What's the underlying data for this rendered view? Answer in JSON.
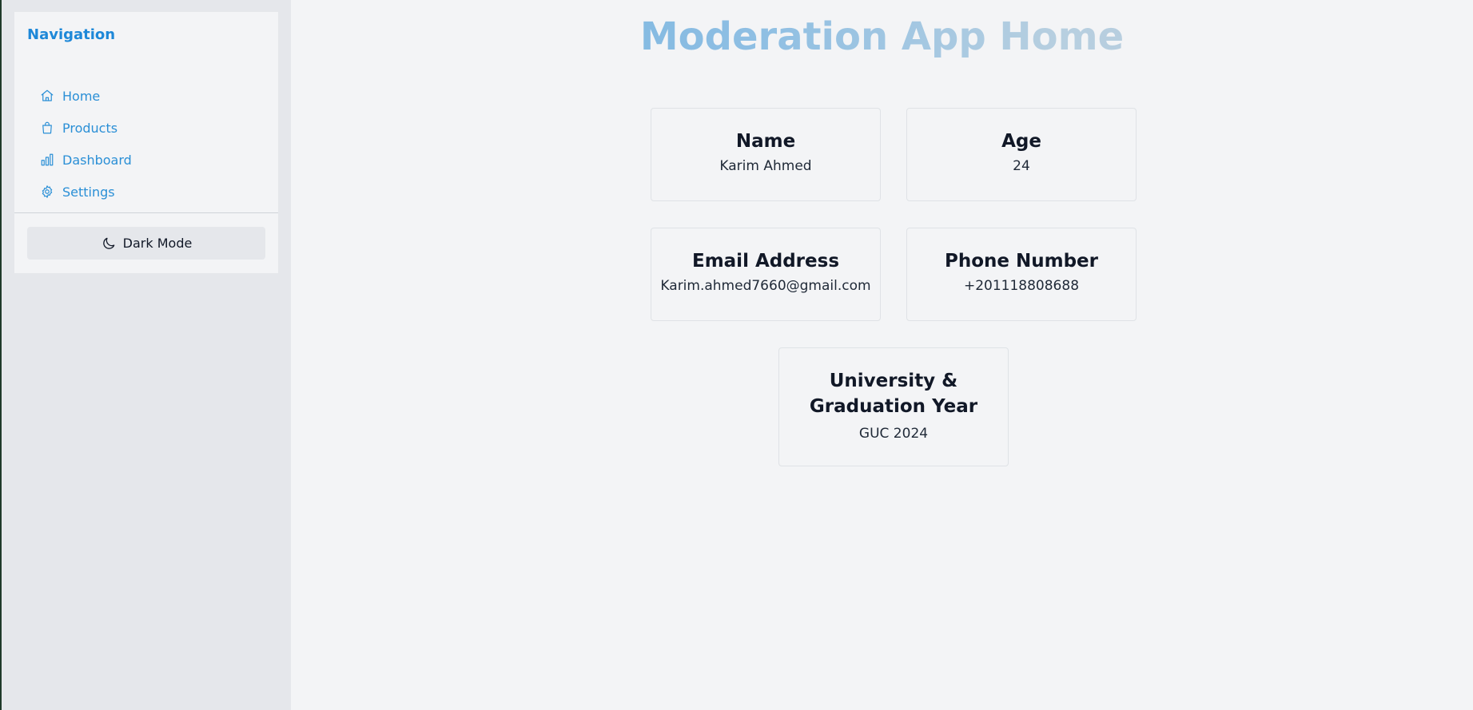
{
  "sidebar": {
    "title": "Navigation",
    "items": [
      {
        "label": "Home",
        "icon": "home-icon"
      },
      {
        "label": "Products",
        "icon": "shopping-bag-icon"
      },
      {
        "label": "Dashboard",
        "icon": "bar-chart-icon"
      },
      {
        "label": "Settings",
        "icon": "gear-icon"
      }
    ],
    "dark_mode_label": "Dark Mode",
    "dark_mode_icon": "moon-icon"
  },
  "main": {
    "title": "Moderation App Home",
    "cards": [
      {
        "label": "Name",
        "value": "Karim Ahmed"
      },
      {
        "label": "Age",
        "value": "24"
      },
      {
        "label": "Email Address",
        "value": "Karim.ahmed7660@gmail.com"
      },
      {
        "label": "Phone Number",
        "value": "+201118808688"
      },
      {
        "label": "University & Graduation Year",
        "value": "GUC 2024"
      }
    ]
  },
  "colors": {
    "accent": "#2a8fd6",
    "background": "#f3f4f6",
    "sidebar_background": "#e5e7eb"
  }
}
